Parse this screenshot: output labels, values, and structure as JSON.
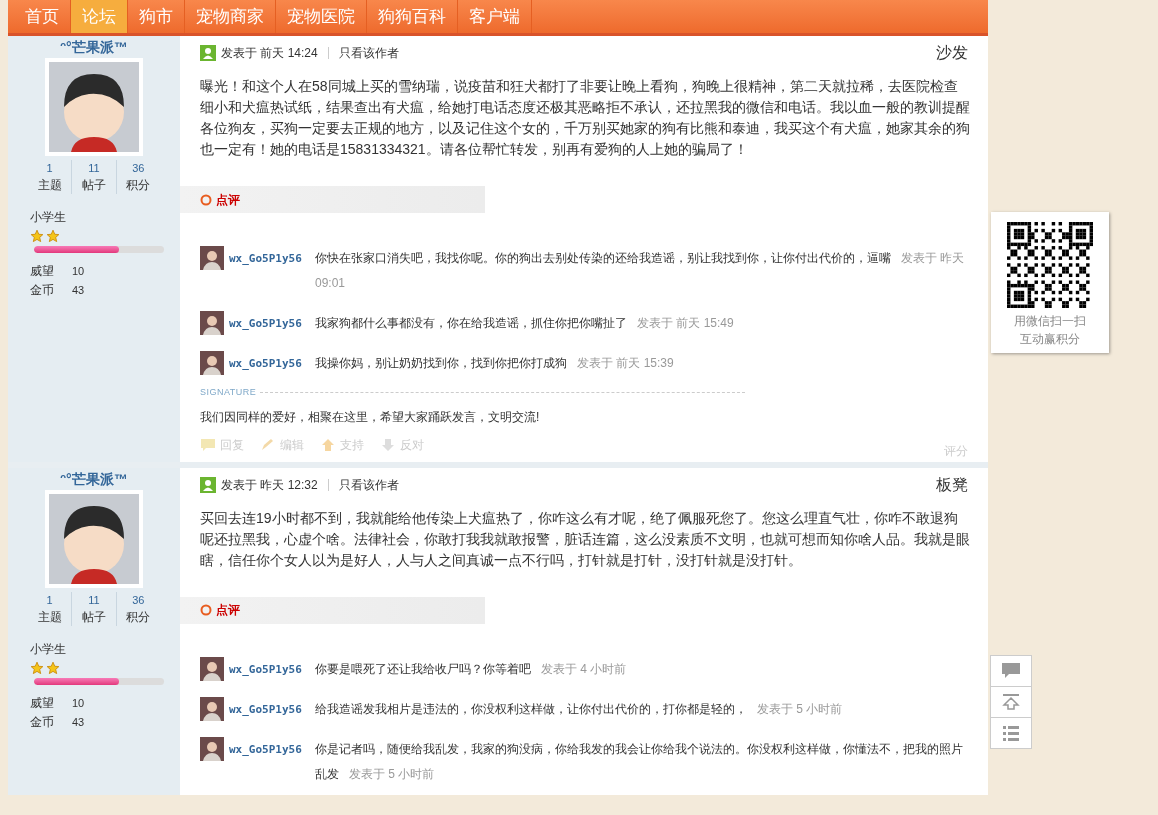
{
  "nav": {
    "items": [
      {
        "label": "首页",
        "selected": false
      },
      {
        "label": "论坛",
        "selected": true
      },
      {
        "label": "狗市",
        "selected": false
      },
      {
        "label": "宠物商家",
        "selected": false
      },
      {
        "label": "宠物医院",
        "selected": false
      },
      {
        "label": "狗狗百科",
        "selected": false
      },
      {
        "label": "客户端",
        "selected": false
      }
    ]
  },
  "posts": [
    {
      "author": {
        "name": "ᵔ°芒果派™",
        "stats": [
          {
            "value": "1",
            "label": "主题"
          },
          {
            "value": "11",
            "label": "帖子"
          },
          {
            "value": "36",
            "label": "积分"
          }
        ],
        "rank": "小学生",
        "rank_icons": [
          {
            "kind": "star"
          },
          {
            "kind": "star"
          }
        ],
        "level": 0.65,
        "fields": [
          {
            "label": "威望",
            "value": "10"
          },
          {
            "label": "金币",
            "value": "43"
          }
        ]
      },
      "posted": "发表于",
      "time": "前天 14:24",
      "author_only": "只看该作者",
      "floor": "沙发",
      "body": "曝光！和这个人在58同城上买的雪纳瑞，说疫苗和狂犬都打了非要让晚上看狗，狗晚上很精神，第二天就拉稀，去医院检查细小和犬瘟热试纸，结果查出有犬瘟，给她打电话态度还极其恶略拒不承认，还拉黑我的微信和电话。我以血一般的教训提醒各位狗友，买狗一定要去正规的地方，以及记住这个女的，千万别买她家的狗有比熊和泰迪，我买这个有犬瘟，她家其余的狗也一定有！她的电话是15831334321。请各位帮忙转发，别再有爱狗的人上她的骗局了！",
      "review_label": "点评",
      "comments": [
        {
          "user": "wx_Go5P1y56",
          "text": "你快在张家口消失吧，我找你呢。你的狗出去别处传染的还给我造谣，别让我找到你，让你付出代价的，逼嘴",
          "time": "发表于 昨天 09:01"
        },
        {
          "user": "wx_Go5P1y56",
          "text": "我家狗都什么事都没有，你在给我造谣，抓住你把你嘴扯了",
          "time": "发表于 前天 15:49"
        },
        {
          "user": "wx_Go5P1y56",
          "text": "我操你妈，别让奶奶找到你，找到你把你打成狗",
          "time": "发表于 前天 15:39"
        }
      ],
      "signature": {
        "label": "SIGNATURE",
        "text": "我们因同样的爱好，相聚在这里，希望大家踊跃发言，文明交流!"
      },
      "actions": [
        "回复",
        "编辑",
        "支持",
        "反对"
      ],
      "rate": "评分"
    },
    {
      "author": {
        "name": "ᵔ°芒果派™",
        "stats": [
          {
            "value": "1",
            "label": "主题"
          },
          {
            "value": "11",
            "label": "帖子"
          },
          {
            "value": "36",
            "label": "积分"
          }
        ],
        "rank": "小学生",
        "rank_icons": [
          {
            "kind": "star"
          },
          {
            "kind": "star"
          }
        ],
        "level": 0.65,
        "fields": [
          {
            "label": "威望",
            "value": "10"
          },
          {
            "label": "金币",
            "value": "43"
          }
        ]
      },
      "posted": "发表于",
      "time": "昨天 12:32",
      "author_only": "只看该作者",
      "floor": "板凳",
      "body": "买回去连19小时都不到，我就能给他传染上犬瘟热了，你咋这么有才呢，绝了佩服死您了。您这么理直气壮，你咋不敢退狗呢还拉黑我，心虚个啥。法律社会，你敢打我我就敢报警，脏话连篇，这么没素质不文明，也就可想而知你啥人品。我就是眼瞎，信任你个女人以为是好人，人与人之间真诚一点不行吗，打针就是打针，没打针就是没打针。",
      "review_label": "点评",
      "comments": [
        {
          "user": "wx_Go5P1y56",
          "text": "你要是喂死了还让我给收尸吗？你等着吧",
          "time": "发表于 4 小时前"
        },
        {
          "user": "wx_Go5P1y56",
          "text": "给我造谣发我相片是违法的，你没权利这样做，让你付出代价的，打你都是轻的，",
          "time": "发表于 5 小时前"
        },
        {
          "user": "wx_Go5P1y56",
          "text": "你是记者吗，随便给我乱发，我家的狗没病，你给我发的我会让你给我个说法的。你没权利这样做，你懂法不，把我的照片乱发",
          "time": "发表于 5 小时前"
        }
      ]
    }
  ],
  "qr": {
    "lines": [
      "用微信扫一扫",
      "互动赢积分"
    ]
  }
}
